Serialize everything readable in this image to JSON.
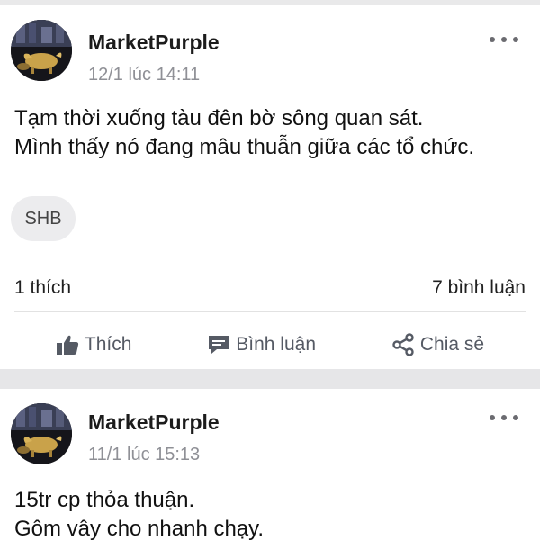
{
  "posts": [
    {
      "author": "MarketPurple",
      "timestamp": "12/1 lúc 14:11",
      "text_lines": [
        "Tạm thời xuống tàu đên bờ sông quan sát.",
        "Mình thấy nó đang mâu thuẫn giữa các tổ chức."
      ],
      "tag": "SHB",
      "likes": "1 thích",
      "comments": "7 bình luận"
    },
    {
      "author": "MarketPurple",
      "timestamp": "11/1 lúc 15:13",
      "text_lines": [
        "15tr cp thỏa thuận.",
        "Gôm vây cho nhanh chạy."
      ]
    }
  ],
  "actions": {
    "like_label": "Thích",
    "comment_label": "Bình luận",
    "share_label": "Chia sẻ"
  },
  "icons": {
    "more": "more-horizontal-icon",
    "like": "thumbs-up-icon",
    "comment": "comment-bubble-icon",
    "share": "share-icon"
  },
  "colors": {
    "separator": "#e6e6e8",
    "muted_text": "#8f9096",
    "action_text": "#555a64"
  }
}
